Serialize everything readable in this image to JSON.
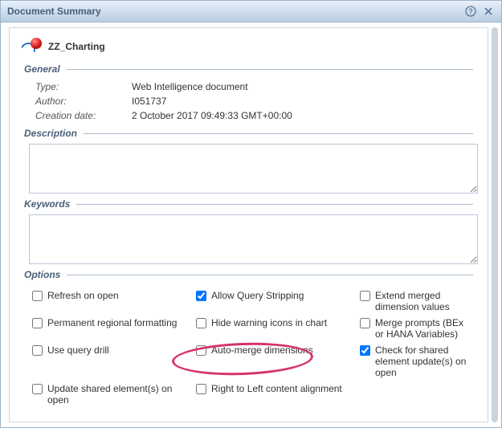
{
  "window": {
    "title": "Document Summary"
  },
  "document": {
    "name": "ZZ_Charting"
  },
  "general": {
    "heading": "General",
    "type_label": "Type:",
    "type_value": "Web Intelligence document",
    "author_label": "Author:",
    "author_value": "I051737",
    "creation_label": "Creation date:",
    "creation_value": "2 October 2017 09:49:33 GMT+00:00"
  },
  "description": {
    "heading": "Description",
    "value": ""
  },
  "keywords": {
    "heading": "Keywords",
    "value": ""
  },
  "options": {
    "heading": "Options",
    "col1": {
      "refresh_on_open": "Refresh on open",
      "permanent_regional": "Permanent regional formatting",
      "use_query_drill": "Use query drill",
      "update_shared_on_open": "Update shared element(s) on open"
    },
    "col2": {
      "allow_query_stripping": "Allow Query Stripping",
      "hide_warning_icons": "Hide warning icons in chart",
      "auto_merge": "Auto-merge dimensions",
      "rtl_alignment": "Right to Left content alignment"
    },
    "col3": {
      "extend_merged": "Extend merged dimension values",
      "merge_prompts": "Merge prompts (BEx or HANA Variables)",
      "check_shared_update": "Check for shared element update(s) on open"
    },
    "checked": {
      "allow_query_stripping": true,
      "check_shared_update": true
    }
  }
}
